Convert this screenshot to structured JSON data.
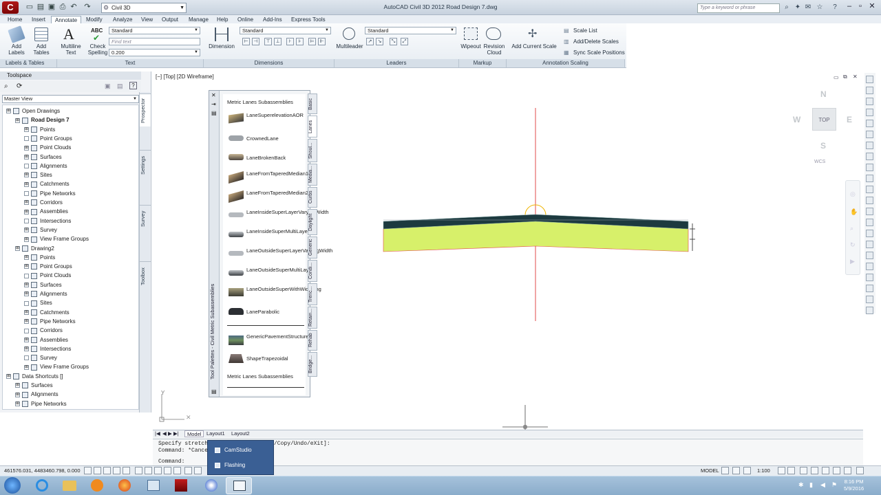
{
  "titlebar": {
    "app_icon_text": "C",
    "workspace": "Civil 3D",
    "window_title": "AutoCAD Civil 3D 2012   Road Design 7.dwg",
    "search_placeholder": "Type a keyword or phrase"
  },
  "menu_tabs": [
    "Home",
    "Insert",
    "Annotate",
    "Modify",
    "Analyze",
    "View",
    "Output",
    "Manage",
    "Help",
    "Online",
    "Add-Ins",
    "Express Tools"
  ],
  "ribbon": {
    "labels_tables": {
      "add_labels": "Add Labels",
      "add_tables": "Add Tables",
      "title": "Labels & Tables"
    },
    "text": {
      "multiline_text": "Multiline Text",
      "abc_icon": "ABC",
      "check_spelling": "Check Spelling",
      "text_style": "Standard",
      "find_placeholder": "Find text",
      "text_height": "0.200",
      "title": "Text"
    },
    "dimensions": {
      "dimension": "Dimension",
      "dim_style": "Standard",
      "title": "Dimensions"
    },
    "leaders": {
      "multileader": "Multileader",
      "leader_style": "Standard",
      "title": "Leaders"
    },
    "markup": {
      "wipeout": "Wipeout",
      "revision_cloud": "Revision Cloud",
      "title": "Markup"
    },
    "annotation_scaling": {
      "add_current_scale": "Add Current Scale",
      "scale_list": "Scale List",
      "add_delete_scales": "Add/Delete Scales",
      "sync_scale_positions": "Sync Scale Positions",
      "title": "Annotation Scaling"
    }
  },
  "toolspace": {
    "title": "Toolspace",
    "view_select": "Master View",
    "side_tabs": [
      "Prospector",
      "Settings",
      "Survey",
      "Toolbox"
    ]
  },
  "tree": [
    {
      "label": "Open Drawings",
      "indent": 0,
      "bold": false
    },
    {
      "label": "Road Design 7",
      "indent": 1,
      "bold": true
    },
    {
      "label": "Points",
      "indent": 2
    },
    {
      "label": "Point Groups",
      "indent": 2
    },
    {
      "label": "Point Clouds",
      "indent": 2
    },
    {
      "label": "Surfaces",
      "indent": 2
    },
    {
      "label": "Alignments",
      "indent": 2
    },
    {
      "label": "Sites",
      "indent": 2
    },
    {
      "label": "Catchments",
      "indent": 2
    },
    {
      "label": "Pipe Networks",
      "indent": 2
    },
    {
      "label": "Corridors",
      "indent": 2
    },
    {
      "label": "Assemblies",
      "indent": 2
    },
    {
      "label": "Intersections",
      "indent": 2
    },
    {
      "label": "Survey",
      "indent": 2
    },
    {
      "label": "View Frame Groups",
      "indent": 2
    },
    {
      "label": "Drawing2",
      "indent": 1
    },
    {
      "label": "Points",
      "indent": 2
    },
    {
      "label": "Point Groups",
      "indent": 2
    },
    {
      "label": "Point Clouds",
      "indent": 2
    },
    {
      "label": "Surfaces",
      "indent": 2
    },
    {
      "label": "Alignments",
      "indent": 2
    },
    {
      "label": "Sites",
      "indent": 2
    },
    {
      "label": "Catchments",
      "indent": 2
    },
    {
      "label": "Pipe Networks",
      "indent": 2
    },
    {
      "label": "Corridors",
      "indent": 2
    },
    {
      "label": "Assemblies",
      "indent": 2
    },
    {
      "label": "Intersections",
      "indent": 2
    },
    {
      "label": "Survey",
      "indent": 2
    },
    {
      "label": "View Frame Groups",
      "indent": 2
    },
    {
      "label": "Data Shortcuts []",
      "indent": 0
    },
    {
      "label": "Surfaces",
      "indent": 1
    },
    {
      "label": "Alignments",
      "indent": 1
    },
    {
      "label": "Pipe Networks",
      "indent": 1
    }
  ],
  "viewport": {
    "label": "[−] [Top] [2D Wireframe]"
  },
  "palette": {
    "header": "Metric Lanes Subassemblies",
    "footer": "Metric Lanes Subassemblies",
    "side_title": "Tool Palettes - Civil Metric Subassemblies",
    "items": [
      "LaneSuperelevationAOR",
      "CrownedLane",
      "LaneBrokenBack",
      "LaneFromTaperedMedian1",
      "LaneFromTaperedMedian2",
      "LaneInsideSuperLayerVaryingWidth",
      "LaneInsideSuperMultiLayer",
      "LaneOutsideSuperLayerVaryingWidth",
      "LaneOutsideSuperMultiLayer",
      "LaneOutsideSuperWithWidening",
      "LaneParabolic",
      "GenericPavementStructure",
      "ShapeTrapezoidal"
    ],
    "tabs": [
      "Basic",
      "Lanes",
      "Shoul...",
      "Media...",
      "Curbs",
      "Daylight",
      "Generic",
      "Condi...",
      "Trenc...",
      "Retain...",
      "Rehab",
      "Bridge..."
    ]
  },
  "navcube": {
    "north": "N",
    "south": "S",
    "east": "E",
    "west": "W",
    "top": "TOP",
    "wcs": "WCS"
  },
  "ucs": {
    "y": "Y"
  },
  "layout_tabs": [
    "Model",
    "Layout1",
    "Layout2"
  ],
  "command": {
    "line1": "Specify stretch",
    "line1_end": "/Copy/Undo/eXit]:",
    "line2": "Command: *Cance",
    "line3": "Command:"
  },
  "status": {
    "coords": "461576.031, 4483460.798, 0.000",
    "model": "MODEL",
    "scale": "1:100"
  },
  "popup": {
    "items": [
      "CamStudio",
      "Flashing"
    ]
  },
  "clock": {
    "time": "8:16 PM",
    "date": "5/9/2016"
  },
  "colors": {
    "pavement_top": "#1d3a3f",
    "pavement_base": "#d7f06a",
    "centerline": "#e24a4a",
    "marker": "#f0b400"
  }
}
